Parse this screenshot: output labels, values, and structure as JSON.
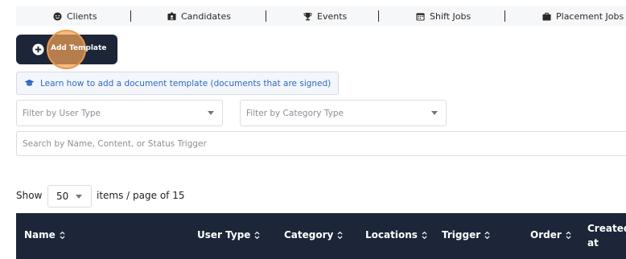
{
  "nav": {
    "items": [
      {
        "label": "Clients",
        "icon": "smile-icon"
      },
      {
        "label": "Candidates",
        "icon": "id-card-icon"
      },
      {
        "label": "Events",
        "icon": "trophy-icon"
      },
      {
        "label": "Shift Jobs",
        "icon": "calendar-icon"
      },
      {
        "label": "Placement Jobs",
        "icon": "briefcase-icon"
      }
    ]
  },
  "toolbar": {
    "add_template_label": "Add Template"
  },
  "info": {
    "link_text": "Learn how to add a document template (documents that are signed)",
    "icon": "graduation-cap-icon"
  },
  "filters": {
    "user_type_placeholder": "Filter by User Type",
    "category_type_placeholder": "Filter by Category Type",
    "search_placeholder": "Search by Name, Content, or Status Trigger"
  },
  "pagination": {
    "show_label": "Show",
    "page_size": "50",
    "items_label": "items / page of 15"
  },
  "table": {
    "columns": [
      "Name",
      "User Type",
      "Category",
      "Locations",
      "Trigger",
      "Order",
      "Created at"
    ]
  },
  "colors": {
    "primary_dark": "#1c2638",
    "link_blue": "#2d6ac1",
    "click_highlight": "#f2a154"
  }
}
